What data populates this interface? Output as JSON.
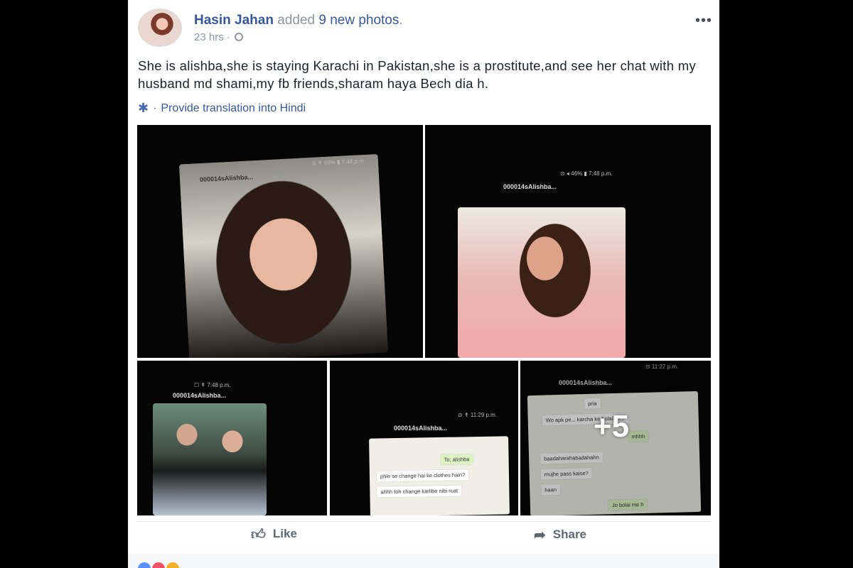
{
  "post": {
    "author": "Hasin Jahan",
    "action_text": "added",
    "photos_label": "9 new photos",
    "period": ".",
    "time": "23 hrs",
    "time_sep": "·",
    "text": "She is alishba,she is staying Karachi in Pakistan,she is a prostitute,and see her chat with my husband md shami,my fb friends,sharam haya Bech dia h.",
    "translate_sep": "·",
    "translate_label": "Provide translation into Hindi",
    "more_menu": "•••"
  },
  "photos": {
    "p1": {
      "chat_title": "000014sAlishba...",
      "status": "⊙ ↟ 59% ▮ 7:48 p.m."
    },
    "p2": {
      "chat_title": "000014sAlishba...",
      "status": "⊙ ◂ 46% ▮ 7:48 p.m."
    },
    "p3": {
      "chat_title": "000014sAlishba...",
      "status": "☐ ↟ 7:48 p.m."
    },
    "p4": {
      "chat_title": "000014sAlishba...",
      "status": "⊙ ↟ 11:29 p.m.",
      "bubbles": [
        "To: alishba",
        "phle se change hai ke clothes hain?",
        "ahhh toh change karlibe nibi ruat"
      ]
    },
    "p5": {
      "chat_title": "000014sAlishba...",
      "status": "⊙ 11:27 p.m.",
      "bubbles": [
        "pria",
        "Wo apk pe... karcha ke bolai se...",
        "mhhh",
        "baadaharahabadahahn",
        "mujhe pass kaise?",
        "haan",
        "Jo bolai me h"
      ],
      "more_count": "+5"
    }
  },
  "actions": {
    "like_label": "Like",
    "share_label": "Share"
  },
  "colors": {
    "link": "#365899",
    "meta": "#90949c",
    "text": "#1d2129",
    "background": "#000000"
  }
}
